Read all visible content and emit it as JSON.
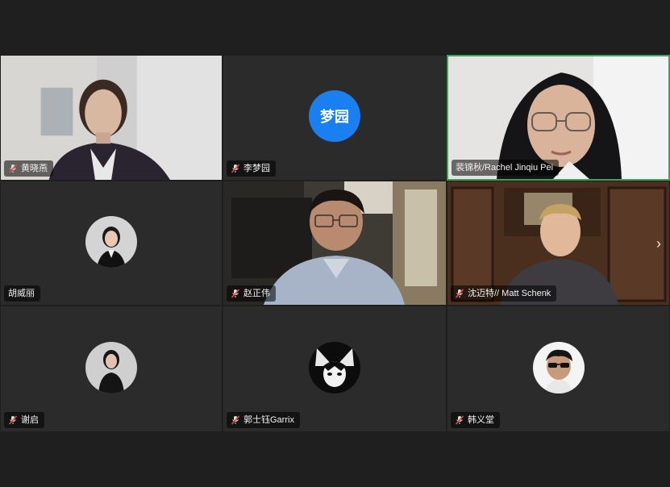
{
  "meeting": {
    "participants": [
      {
        "name": "黄晓燕",
        "muted": true,
        "type": "video"
      },
      {
        "name": "李梦园",
        "muted": true,
        "type": "initials",
        "initials": "梦园",
        "avatar_color": "#1a7ff0"
      },
      {
        "name": "裴锦秋/Rachel Jinqiu Pei",
        "muted": false,
        "type": "video",
        "active_speaker": true
      },
      {
        "name": "胡威丽",
        "muted": false,
        "type": "photo"
      },
      {
        "name": "赵正伟",
        "muted": true,
        "type": "video"
      },
      {
        "name": "沈迈特// Matt Schenk",
        "muted": true,
        "type": "video"
      },
      {
        "name": "谢启",
        "muted": true,
        "type": "photo"
      },
      {
        "name": "郭士钰Garrix",
        "muted": true,
        "type": "photo"
      },
      {
        "name": "韩义堂",
        "muted": true,
        "type": "photo"
      }
    ],
    "next_page_icon": "chevron-right-icon",
    "active_speaker_color": "#3aa757"
  }
}
